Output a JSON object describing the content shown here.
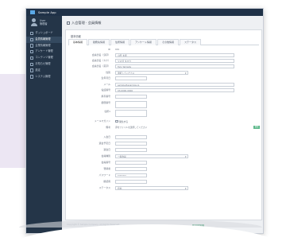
{
  "app": {
    "title": "Sample App"
  },
  "user": {
    "name": "User",
    "role": "管理者"
  },
  "sidebar": {
    "items": [
      {
        "label": "ダッシュボード"
      },
      {
        "label": "会員情報管理"
      },
      {
        "label": "企業情報管理"
      },
      {
        "label": "アンケート管理"
      },
      {
        "label": "コンテンツ管理"
      },
      {
        "label": "お知らせ管理"
      },
      {
        "label": "設定"
      },
      {
        "label": "システム管理"
      }
    ]
  },
  "breadcrumb": {
    "text": "入会管理 · 会員情報"
  },
  "card": {
    "section_title": "基本情報"
  },
  "tabs": [
    "基本情報",
    "勤務先情報",
    "住所情報",
    "アンケート情報",
    "その他情報",
    "ステータス"
  ],
  "form": {
    "rows": [
      {
        "label": "ID",
        "value": "001",
        "kind": "plain"
      },
      {
        "label": "会員氏名（漢字）",
        "value": "山田 太郎",
        "kind": "input"
      },
      {
        "label": "会員氏名（カナ）",
        "value": "ヤマダ タロウ",
        "kind": "input"
      },
      {
        "label": "会員氏名（英字）",
        "value": "Taro Yamada",
        "kind": "input"
      },
      {
        "label": "性別",
        "value": "選択してください",
        "kind": "select"
      },
      {
        "label": "生年月日",
        "value": "",
        "kind": "input"
      },
      {
        "label": "メール",
        "value": "sample@example.jp",
        "kind": "input"
      },
      {
        "label": "電話番号",
        "value": "03-0000-0000",
        "kind": "input"
      },
      {
        "label": "携帯番号",
        "value": "",
        "kind": "input"
      },
      {
        "label": "郵便番号",
        "value": "",
        "kind": "input"
      },
      {
        "label": "住所1",
        "value": "",
        "kind": "input"
      },
      {
        "label": "メールマガジン",
        "value": "受信する",
        "kind": "checkbox"
      },
      {
        "label": "備考",
        "value": "添付ファイルを選択してください",
        "kind": "file",
        "button": "参照"
      },
      {
        "label": "入会日",
        "value": "",
        "kind": "input"
      },
      {
        "label": "退会予定日",
        "value": "",
        "kind": "input"
      },
      {
        "label": "退会日",
        "value": "",
        "kind": "input"
      },
      {
        "label": "会員種別",
        "value": "一般会員",
        "kind": "select"
      },
      {
        "label": "会員番号",
        "value": "",
        "kind": "input"
      },
      {
        "label": "登録者",
        "value": "",
        "kind": "input"
      },
      {
        "label": "パスワード",
        "value": "********",
        "kind": "input"
      },
      {
        "label": "確認用",
        "value": "",
        "kind": "input"
      },
      {
        "label": "ステータス",
        "value": "有効",
        "kind": "select"
      }
    ],
    "submit_label": "登録する"
  },
  "footer": {
    "text": "Copyright © Sample Company. All Rights Reserved."
  },
  "colors": {
    "topbar": "#1f3147",
    "sidebar": "#243548",
    "accent_green": "#3f9e72",
    "background": "#eef0f3"
  }
}
